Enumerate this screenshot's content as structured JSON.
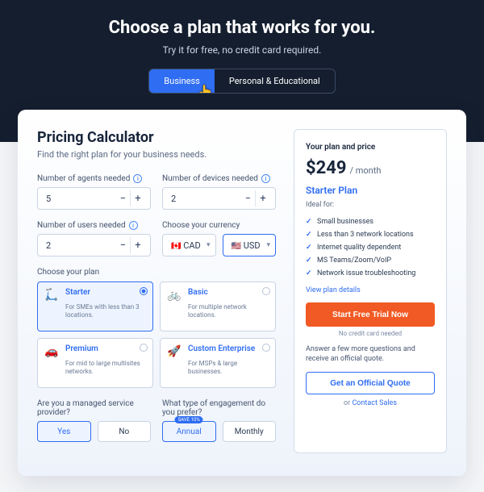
{
  "hero": {
    "title": "Choose a plan that works for you.",
    "subtitle": "Try it for free, no credit card required.",
    "tabs": {
      "business": "Business",
      "personal": "Personal & Educational"
    }
  },
  "calc": {
    "title": "Pricing Calculator",
    "subtitle": "Find the right plan for your business needs.",
    "agents": {
      "label": "Number of agents needed",
      "value": "5"
    },
    "devices": {
      "label": "Number of devices needed",
      "value": "2"
    },
    "users": {
      "label": "Number of users needed",
      "value": "2"
    },
    "currency": {
      "label": "Choose your currency",
      "options": [
        {
          "flag": "🇨🇦",
          "code": "CAD"
        },
        {
          "flag": "🇺🇸",
          "code": "USD"
        }
      ]
    },
    "plan_label": "Choose your plan",
    "plans": [
      {
        "name": "Starter",
        "desc": "For SMEs with less than 3 locations.",
        "icon": "🛴"
      },
      {
        "name": "Basic",
        "desc": "For multiple network locations.",
        "icon": "🚲"
      },
      {
        "name": "Premium",
        "desc": "For mid to large multisites networks.",
        "icon": "🚗"
      },
      {
        "name": "Custom Enterprise",
        "desc": "For MSPs & large businesses.",
        "icon": "🚀"
      }
    ],
    "msp": {
      "label": "Are you a managed service provider?",
      "yes": "Yes",
      "no": "No"
    },
    "engagement": {
      "label": "What type of engagement do you prefer?",
      "annual": "Annual",
      "monthly": "Monthly",
      "save_badge": "SAVE 10%"
    }
  },
  "summary": {
    "header": "Your plan and price",
    "price": "$249",
    "per": "/ month",
    "plan_name": "Starter Plan",
    "ideal_label": "Ideal for:",
    "features": [
      "Small businesses",
      "Less than 3 network locations",
      "Internet quality dependent",
      "MS Teams/Zoom/VoIP",
      "Network issue troubleshooting"
    ],
    "details_link": "View plan details",
    "cta": "Start Free Trial Now",
    "no_card": "No credit card needed",
    "answer_more": "Answer a few more questions and receive an official quote.",
    "quote_btn": "Get an Official Quote",
    "or_text": "or ",
    "contact": "Contact Sales"
  }
}
